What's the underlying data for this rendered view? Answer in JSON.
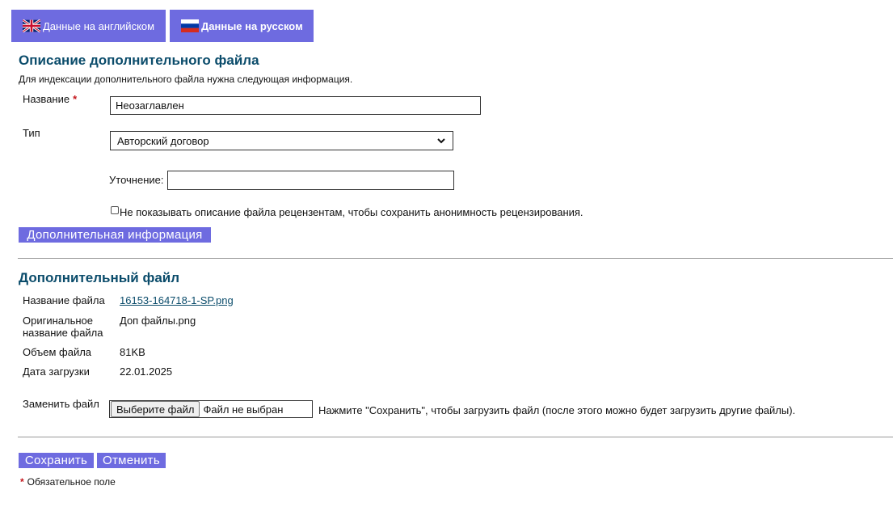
{
  "tabs": {
    "english_label": "Данные на английском",
    "russian_label": "Данные на русском"
  },
  "description": {
    "heading": "Описание дополнительного файла",
    "intro": "Для индексации дополнительного файла нужна следующая информация.",
    "title_label": "Название",
    "title_value": "Неозаглавлен",
    "type_label": "Тип",
    "type_selected": "Авторский договор",
    "specify_label": "Уточнение:",
    "specify_value": "",
    "hide_checkbox_label": "Не показывать описание файла рецензентам, чтобы сохранить анонимность рецензирования.",
    "more_info_button": "Дополнительная информация"
  },
  "file": {
    "heading": "Дополнительный файл",
    "filename_label": "Название файла",
    "filename_value": "16153-164718-1-SP.png",
    "original_label_line1": "Оригинальное",
    "original_label_line2": "название файла",
    "original_value": "Доп файлы.png",
    "size_label": "Объем файла",
    "size_value": "81KB",
    "date_label": "Дата загрузки",
    "date_value": "22.01.2025",
    "replace_label": "Заменить файл",
    "choose_button": "Выберите файл",
    "no_file_text": "Файл не выбран",
    "save_hint": "Нажмите \"Сохранить\", чтобы загрузить файл (после этого можно будет загрузить другие файлы)."
  },
  "actions": {
    "save": "Сохранить",
    "cancel": "Отменить"
  },
  "footer": {
    "required_star": "*",
    "required_note": "Обязательное поле"
  },
  "colors": {
    "accent": "#6e6be0",
    "heading": "#0b4c6b",
    "required": "#c4161c"
  }
}
